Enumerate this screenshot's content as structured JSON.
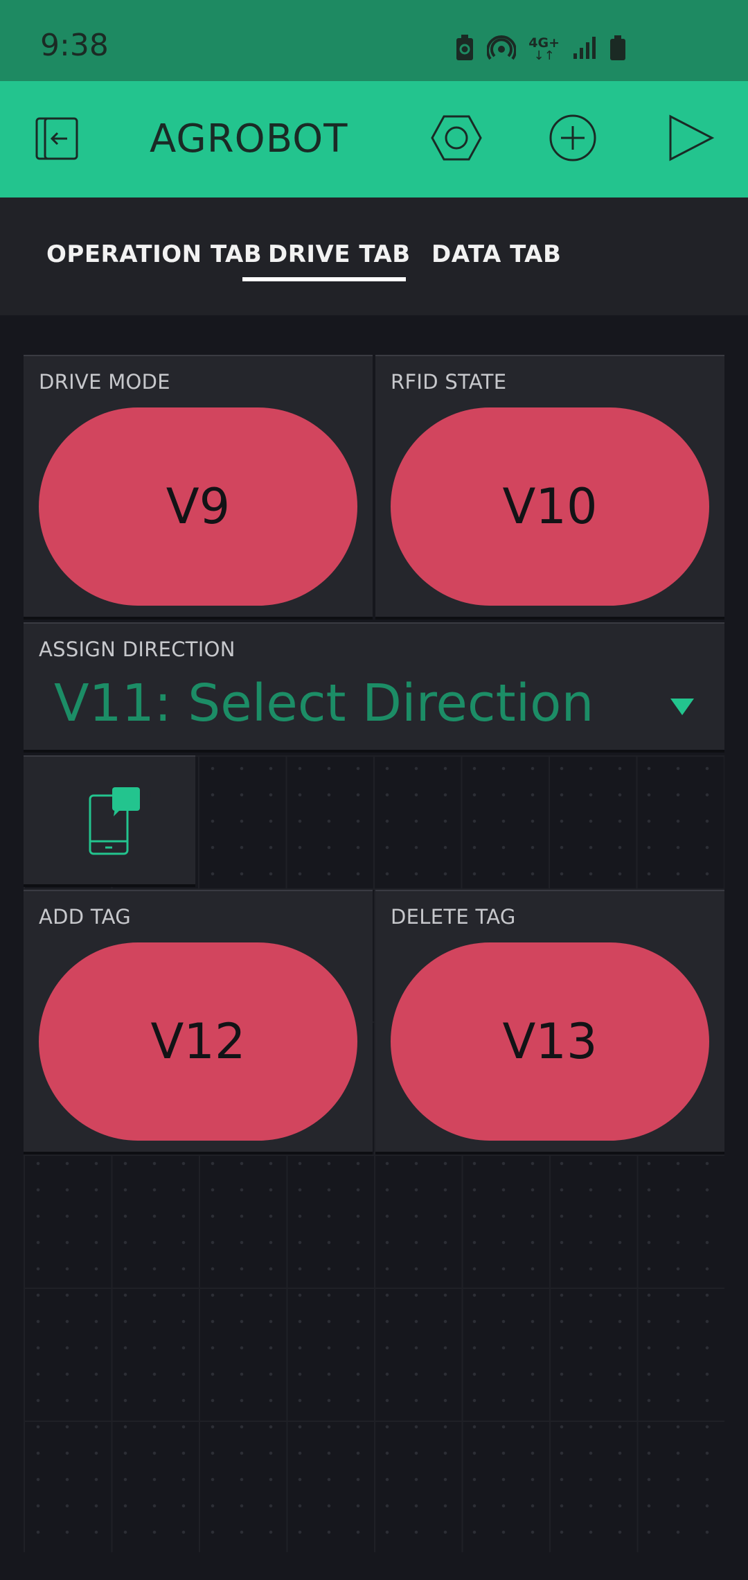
{
  "status_bar": {
    "time": "9:38",
    "icons": [
      "battery-saver-icon",
      "hotspot-icon",
      "network-4g-plus-icon",
      "signal-icon",
      "battery-icon"
    ],
    "network_label": "4G+"
  },
  "app_bar": {
    "title": "AGROBOT",
    "icons": [
      "exit-icon",
      "settings-hexagon-icon",
      "add-circle-icon",
      "play-icon"
    ]
  },
  "tabs": {
    "items": [
      {
        "label": "OPERATION TAB"
      },
      {
        "label": "DRIVE TAB"
      },
      {
        "label": "DATA TAB"
      }
    ],
    "active": "DRIVE TAB"
  },
  "widgets": {
    "drive_mode": {
      "label": "DRIVE MODE",
      "button": "V9"
    },
    "rfid_state": {
      "label": "RFID STATE",
      "button": "V10"
    },
    "assign_direction": {
      "label": "ASSIGN DIRECTION",
      "value": "V11: Select Direction"
    },
    "notification": {
      "icon": "phone-alert-icon",
      "badge": "!"
    },
    "add_tag": {
      "label": "ADD TAG",
      "button": "V12"
    },
    "delete_tag": {
      "label": "DELETE TAG",
      "button": "V13"
    }
  },
  "colors": {
    "status_bar": "#1e8a62",
    "app_bar": "#23c48e",
    "button": "#d2455e",
    "accent": "#23c48e",
    "background": "#16171d"
  }
}
